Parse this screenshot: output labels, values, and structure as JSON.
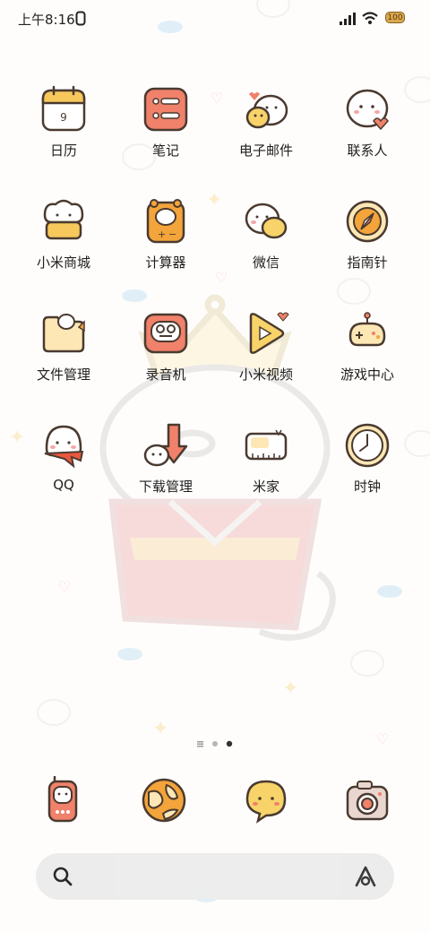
{
  "status_bar": {
    "time": "上午8:16",
    "icons": [
      "signal-icon",
      "wifi-icon",
      "battery-icon"
    ],
    "battery": "100"
  },
  "apps": [
    {
      "label": "日历",
      "icon": "calendar-icon",
      "day": "9"
    },
    {
      "label": "笔记",
      "icon": "notes-icon"
    },
    {
      "label": "电子邮件",
      "icon": "email-icon"
    },
    {
      "label": "联系人",
      "icon": "contacts-icon"
    },
    {
      "label": "小米商城",
      "icon": "mi-store-icon"
    },
    {
      "label": "计算器",
      "icon": "calculator-icon"
    },
    {
      "label": "微信",
      "icon": "wechat-icon"
    },
    {
      "label": "指南针",
      "icon": "compass-icon"
    },
    {
      "label": "文件管理",
      "icon": "file-manager-icon"
    },
    {
      "label": "录音机",
      "icon": "recorder-icon"
    },
    {
      "label": "小米视频",
      "icon": "mi-video-icon"
    },
    {
      "label": "游戏中心",
      "icon": "game-center-icon"
    },
    {
      "label": "QQ",
      "icon": "qq-icon"
    },
    {
      "label": "下载管理",
      "icon": "download-manager-icon"
    },
    {
      "label": "米家",
      "icon": "mijia-icon"
    },
    {
      "label": "时钟",
      "icon": "clock-icon"
    }
  ],
  "page_indicator": {
    "pages": 3,
    "current": 3
  },
  "dock": [
    {
      "icon": "phone-icon"
    },
    {
      "icon": "browser-icon"
    },
    {
      "icon": "messages-icon"
    },
    {
      "icon": "camera-icon"
    }
  ],
  "search_bar": {
    "icons": [
      "search-icon",
      "assistant-icon"
    ]
  },
  "colors": {
    "background": "#fffdfb",
    "outline": "#4a3a30",
    "red": "#f0816a",
    "orange": "#f3a43a",
    "cream": "#fde7b5",
    "yellow": "#f7d36a"
  }
}
